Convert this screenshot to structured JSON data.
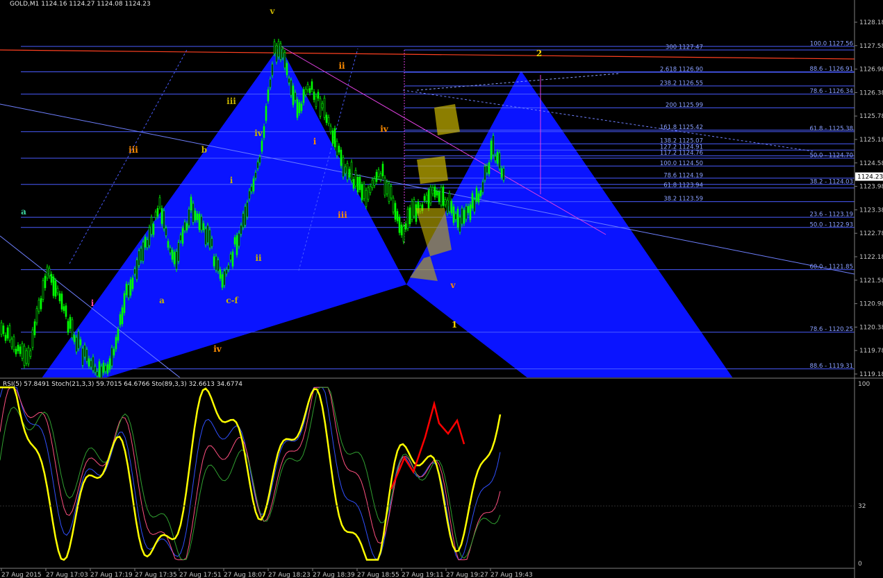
{
  "header": {
    "title": "GOLD,M1  1124.16 1124.27 1124.08 1124.23",
    "indicator_title": "RSI(5) 57.8491  Stoch(21,3,3) 59.7015 64.6766  Sto(89,3,3) 32.6613 34.6774"
  },
  "price_axis": {
    "ticks": [
      "1128.18",
      "1127.58",
      "1126.98",
      "1126.38",
      "1125.78",
      "1125.18",
      "1124.58",
      "1123.98",
      "1123.38",
      "1122.78",
      "1122.18",
      "1121.58",
      "1120.98",
      "1120.38",
      "1119.78",
      "1119.18"
    ],
    "current_price": "1124.23"
  },
  "indicator_axis": {
    "ticks": [
      "100",
      "32",
      "0"
    ]
  },
  "time_axis": {
    "labels": [
      "27 Aug 2015",
      "27 Aug 17:03",
      "27 Aug 17:19",
      "27 Aug 17:35",
      "27 Aug 17:51",
      "27 Aug 18:07",
      "27 Aug 18:23",
      "27 Aug 18:39",
      "27 Aug 18:55",
      "27 Aug 19:11",
      "27 Aug 19:27",
      "27 Aug 19:43"
    ]
  },
  "fib_levels": [
    {
      "label": "100.0  1127.56",
      "price": 1127.56,
      "side": "right"
    },
    {
      "label": "300  1127.47",
      "price": 1127.47,
      "side": "mid"
    },
    {
      "label": "2.618  1126.90",
      "price": 1126.9,
      "side": "mid"
    },
    {
      "label": "88.6 - 1126.91",
      "price": 1126.91,
      "side": "right"
    },
    {
      "label": "238.2  1126.55",
      "price": 1126.55,
      "side": "mid"
    },
    {
      "label": "78.6 - 1126.34",
      "price": 1126.34,
      "side": "right"
    },
    {
      "label": "200  1125.99",
      "price": 1125.99,
      "side": "mid"
    },
    {
      "label": "161.8  1125.42",
      "price": 1125.42,
      "side": "mid"
    },
    {
      "label": "61.8 - 1125.38",
      "price": 1125.38,
      "side": "right"
    },
    {
      "label": "138.2  1125.07",
      "price": 1125.07,
      "side": "mid"
    },
    {
      "label": "127.2  1124.91",
      "price": 1124.91,
      "side": "mid"
    },
    {
      "label": "117.2  1124.76",
      "price": 1124.76,
      "side": "mid"
    },
    {
      "label": "50.0 - 1124.70",
      "price": 1124.7,
      "side": "right"
    },
    {
      "label": "100.0  1124.50",
      "price": 1124.5,
      "side": "mid"
    },
    {
      "label": "78.6  1124.19",
      "price": 1124.19,
      "side": "mid"
    },
    {
      "label": "38.2 - 1124.03",
      "price": 1124.03,
      "side": "right"
    },
    {
      "label": "61.8  1123.94",
      "price": 1123.94,
      "side": "mid"
    },
    {
      "label": "38.2  1123.59",
      "price": 1123.59,
      "side": "mid"
    },
    {
      "label": "23.6 - 1123.19",
      "price": 1123.19,
      "side": "right"
    },
    {
      "label": "50.0 - 1122.93",
      "price": 1122.93,
      "side": "right"
    },
    {
      "label": "60.0 - 1121.85",
      "price": 1121.85,
      "side": "right"
    },
    {
      "label": "78.6 - 1120.25",
      "price": 1120.25,
      "side": "right"
    },
    {
      "label": "88.6 - 1119.31",
      "price": 1119.31,
      "side": "right"
    }
  ],
  "wave_labels": [
    {
      "text": "v",
      "color": "#c8b400"
    },
    {
      "text": "ii",
      "color": "#ff8c00"
    },
    {
      "text": "iii",
      "color": "#c8b400"
    },
    {
      "text": "iv",
      "color": "#c8b400"
    },
    {
      "text": "iii",
      "color": "#ff8c00"
    },
    {
      "text": "b",
      "color": "#c8b400"
    },
    {
      "text": "i",
      "color": "#ff8c00"
    },
    {
      "text": "iv",
      "color": "#ff8c00"
    },
    {
      "text": "i",
      "color": "#c8b400"
    },
    {
      "text": "a",
      "color": "#3cd4a0"
    },
    {
      "text": "a",
      "color": "#c8b400"
    },
    {
      "text": "ii",
      "color": "#c8b400"
    },
    {
      "text": "iii",
      "color": "#ff8c00"
    },
    {
      "text": "i",
      "color": "#ff4aa0"
    },
    {
      "text": "c-f",
      "color": "#c8b400"
    },
    {
      "text": "iv",
      "color": "#ff8c00"
    },
    {
      "text": "v",
      "color": "#ff8c00"
    },
    {
      "text": "1",
      "color": "#ffd700"
    },
    {
      "text": "2",
      "color": "#ffd700"
    }
  ],
  "colors": {
    "background": "#000000",
    "pattern_fill": "#0a14ff",
    "candle": "#00ff00",
    "fib_line": "#4a5cff",
    "rsi": "#ffff00",
    "stoch_fast": "#ff5080",
    "stoch_slow": "#30a030",
    "annotation": "#ff0000"
  }
}
